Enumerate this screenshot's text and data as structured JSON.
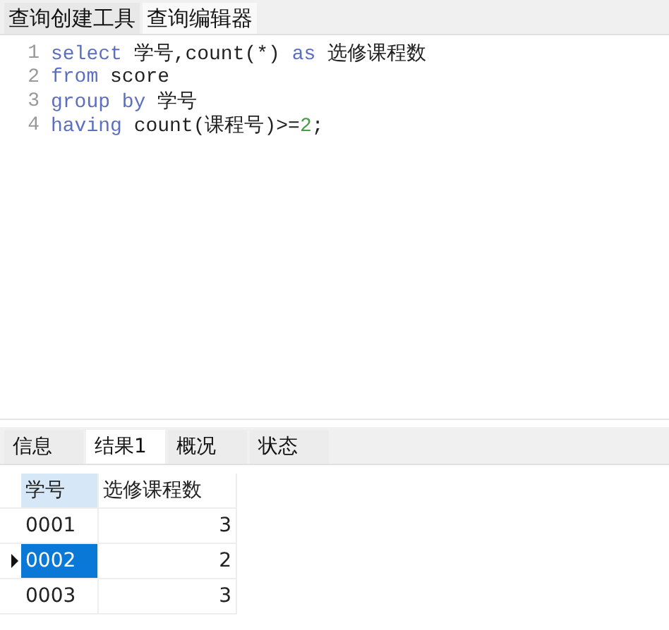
{
  "top_tabs": [
    {
      "label": "查询创建工具",
      "selected": false
    },
    {
      "label": "查询编辑器",
      "selected": true
    }
  ],
  "editor": {
    "lines": [
      {
        "number": "1",
        "tokens": [
          {
            "kind": "keyword",
            "text": "select"
          },
          {
            "kind": "plain",
            "text": " 学号,count(*) "
          },
          {
            "kind": "keyword",
            "text": "as"
          },
          {
            "kind": "plain",
            "text": " 选修课程数"
          }
        ]
      },
      {
        "number": "2",
        "tokens": [
          {
            "kind": "keyword",
            "text": "from"
          },
          {
            "kind": "plain",
            "text": " score"
          }
        ]
      },
      {
        "number": "3",
        "tokens": [
          {
            "kind": "keyword",
            "text": "group by"
          },
          {
            "kind": "plain",
            "text": " 学号"
          }
        ]
      },
      {
        "number": "4",
        "tokens": [
          {
            "kind": "keyword",
            "text": "having"
          },
          {
            "kind": "plain",
            "text": " count(课程号)>="
          },
          {
            "kind": "number",
            "text": "2"
          },
          {
            "kind": "plain",
            "text": ";"
          }
        ]
      }
    ]
  },
  "result_tabs": [
    {
      "label": "信息",
      "selected": false
    },
    {
      "label": "结果1",
      "selected": true
    },
    {
      "label": "概况",
      "selected": false
    },
    {
      "label": "状态",
      "selected": false
    }
  ],
  "grid": {
    "columns": [
      "学号",
      "选修课程数"
    ],
    "rows": [
      {
        "cells": [
          "0001",
          "3"
        ],
        "selected": false
      },
      {
        "cells": [
          "0002",
          "2"
        ],
        "selected": true
      },
      {
        "cells": [
          "0003",
          "3"
        ],
        "selected": false
      }
    ]
  }
}
